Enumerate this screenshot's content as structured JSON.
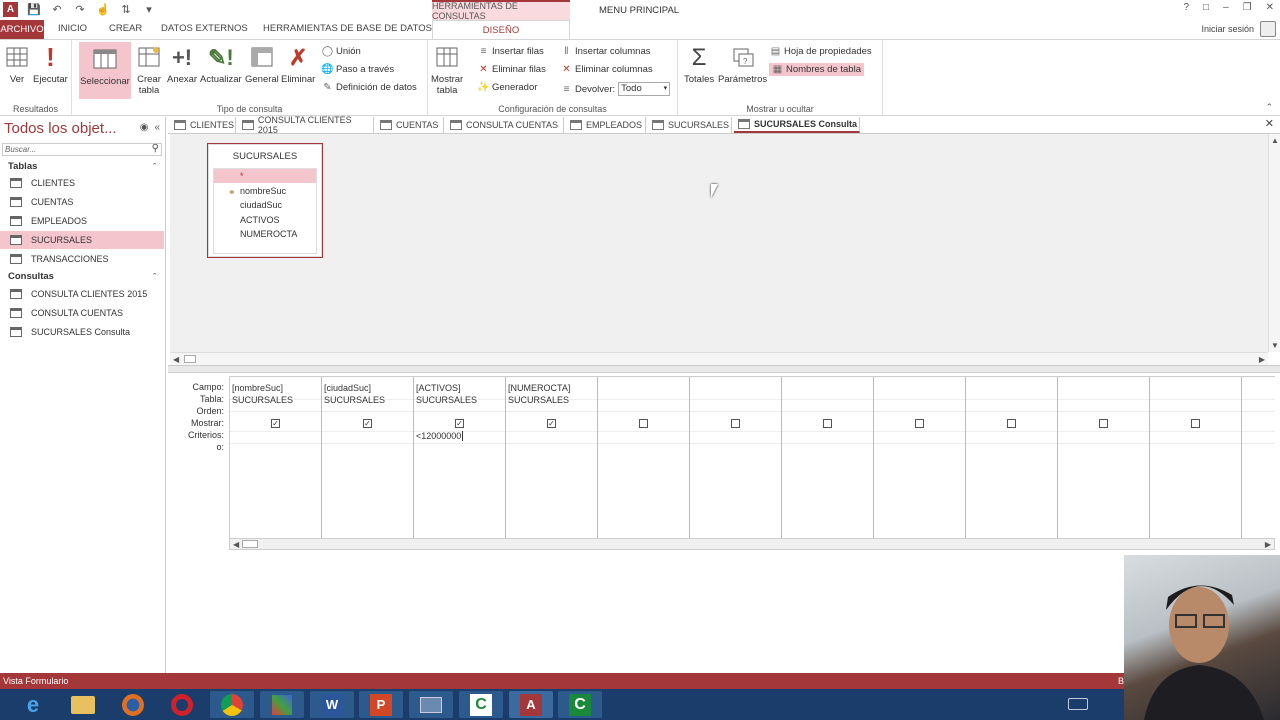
{
  "titlebar": {
    "context_tab_header": "HERRAMIENTAS DE CONSULTAS",
    "window_title": "MENU PRINCIPAL"
  },
  "tabs": {
    "archivo": "ARCHIVO",
    "inicio": "INICIO",
    "crear": "CREAR",
    "datos_externos": "DATOS EXTERNOS",
    "herramientas_bd": "HERRAMIENTAS DE BASE DE DATOS",
    "diseno": "DISEÑO"
  },
  "signin": "Iniciar sesión",
  "ribbon": {
    "resultados": {
      "label": "Resultados",
      "ver": "Ver",
      "ejecutar": "Ejecutar"
    },
    "tipo": {
      "label": "Tipo de consulta",
      "seleccionar": "Seleccionar",
      "crear_tabla_1": "Crear",
      "crear_tabla_2": "tabla",
      "anexar": "Anexar",
      "actualizar": "Actualizar",
      "general": "General",
      "eliminar": "Eliminar",
      "union": "Unión",
      "paso": "Paso a través",
      "definicion": "Definición de datos"
    },
    "config": {
      "label": "Configuración de consultas",
      "mostrar_tabla_1": "Mostrar",
      "mostrar_tabla_2": "tabla",
      "insertar_filas": "Insertar filas",
      "eliminar_filas": "Eliminar filas",
      "generador": "Generador",
      "insertar_columnas": "Insertar columnas",
      "eliminar_columnas": "Eliminar columnas",
      "devolver": "Devolver:",
      "devolver_value": "Todo"
    },
    "mostrar": {
      "label": "Mostrar u ocultar",
      "totales": "Totales",
      "parametros": "Parámetros",
      "hoja_propiedades": "Hoja de propiedades",
      "nombres_tabla": "Nombres de tabla"
    }
  },
  "nav": {
    "title": "Todos los objet...",
    "search_placeholder": "Buscar...",
    "tablas_header": "Tablas",
    "tablas": [
      "CLIENTES",
      "CUENTAS",
      "EMPLEADOS",
      "SUCURSALES",
      "TRANSACCIONES"
    ],
    "consultas_header": "Consultas",
    "consultas": [
      "CONSULTA CLIENTES 2015",
      "CONSULTA CUENTAS",
      "SUCURSALES Consulta"
    ]
  },
  "doc_tabs": [
    "CLIENTES",
    "CONSULTA CLIENTES 2015",
    "CUENTAS",
    "CONSULTA CUENTAS",
    "EMPLEADOS",
    "SUCURSALES",
    "SUCURSALES Consulta"
  ],
  "table_box": {
    "title": "SUCURSALES",
    "fields": [
      "*",
      "nombreSuc",
      "ciudadSuc",
      "ACTIVOS",
      "NUMEROCTA"
    ]
  },
  "qbe": {
    "row_labels": [
      "Campo:",
      "Tabla:",
      "Orden:",
      "Mostrar:",
      "Criterios:",
      "o:"
    ],
    "columns": [
      {
        "campo": "[nombreSuc]",
        "tabla": "SUCURSALES",
        "mostrar": true,
        "criterios": ""
      },
      {
        "campo": "[ciudadSuc]",
        "tabla": "SUCURSALES",
        "mostrar": true,
        "criterios": ""
      },
      {
        "campo": "[ACTIVOS]",
        "tabla": "SUCURSALES",
        "mostrar": true,
        "criterios": "<12000000"
      },
      {
        "campo": "[NUMEROCTA]",
        "tabla": "SUCURSALES",
        "mostrar": true,
        "criterios": ""
      }
    ],
    "empty_columns": 7
  },
  "status": {
    "left": "Vista Formulario",
    "right": "B"
  },
  "taskbar_apps": [
    "ie",
    "explorer",
    "firefox",
    "opera",
    "chrome",
    "paint",
    "word",
    "powerpoint",
    "network",
    "camtasia",
    "access",
    "camtasia-2"
  ],
  "colors": {
    "accent": "#a4373a",
    "selected": "#f4c5cc",
    "taskbar": "#1b3d6b"
  }
}
